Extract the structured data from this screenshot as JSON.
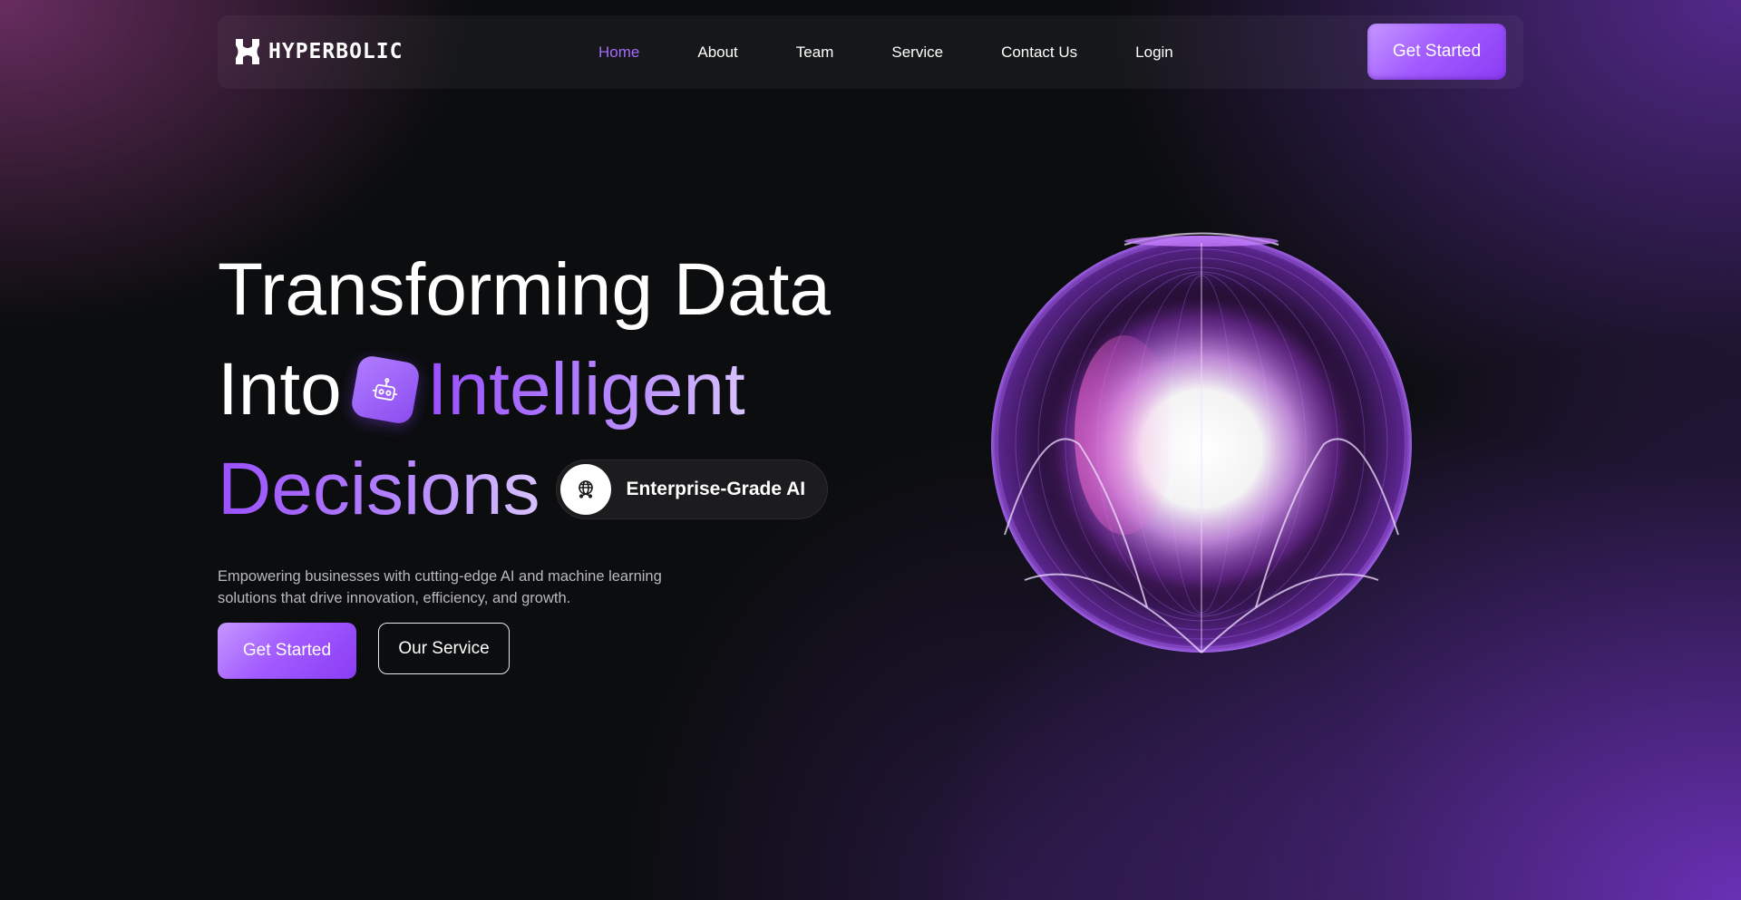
{
  "brand": {
    "name": "HYPERBOLIC",
    "logo_icon": "hyperbolic-logo-icon"
  },
  "nav": {
    "items": [
      {
        "label": "Home",
        "active": true
      },
      {
        "label": "About",
        "active": false
      },
      {
        "label": "Team",
        "active": false
      },
      {
        "label": "Service",
        "active": false
      },
      {
        "label": "Contact Us",
        "active": false
      },
      {
        "label": "Login",
        "active": false
      }
    ],
    "cta_label": "Get Started"
  },
  "hero": {
    "line1": "Transforming Data",
    "line2_prefix": "Into",
    "line2_highlight": "Intelligent",
    "line3_highlight": "Decisions",
    "badge_icon": "robot-icon",
    "pill_icon": "network-globe-icon",
    "pill_label": "Enterprise-Grade AI",
    "description": "Empowering businesses with cutting-edge AI and machine learning solutions that drive innovation, efficiency, and growth.",
    "primary_button": "Get Started",
    "secondary_button": "Our Service",
    "visual": "glowing-sphere"
  },
  "colors": {
    "accent": "#a66bff",
    "button_gradient_start": "#c598ff",
    "button_gradient_end": "#8a3cf4",
    "background": "#0b0d0e"
  }
}
